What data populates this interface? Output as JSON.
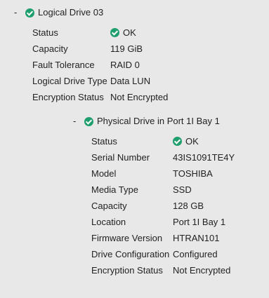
{
  "logical_drive": {
    "toggle": "-",
    "title": "Logical Drive 03",
    "properties": [
      {
        "label": "Status",
        "value": "OK",
        "icon": "check-circle-icon"
      },
      {
        "label": "Capacity",
        "value": "119 GiB"
      },
      {
        "label": "Fault Tolerance",
        "value": "RAID 0"
      },
      {
        "label": "Logical Drive Type",
        "value": "Data LUN"
      },
      {
        "label": "Encryption Status",
        "value": "Not Encrypted"
      }
    ]
  },
  "physical_drive": {
    "toggle": "-",
    "title": "Physical Drive in Port 1I Bay 1",
    "properties": [
      {
        "label": "Status",
        "value": "OK",
        "icon": "check-circle-icon"
      },
      {
        "label": "Serial Number",
        "value": "43IS1091TE4Y"
      },
      {
        "label": "Model",
        "value": "TOSHIBA"
      },
      {
        "label": "Media Type",
        "value": "SSD"
      },
      {
        "label": "Capacity",
        "value": "128 GB"
      },
      {
        "label": "Location",
        "value": "Port 1I Bay 1"
      },
      {
        "label": "Firmware Version",
        "value": "HTRAN101"
      },
      {
        "label": "Drive Configuration",
        "value": "Configured"
      },
      {
        "label": "Encryption Status",
        "value": "Not Encrypted"
      }
    ]
  },
  "colors": {
    "background": "#e8e8e8",
    "status_ok": "#1f9e6e",
    "text": "#222222"
  }
}
